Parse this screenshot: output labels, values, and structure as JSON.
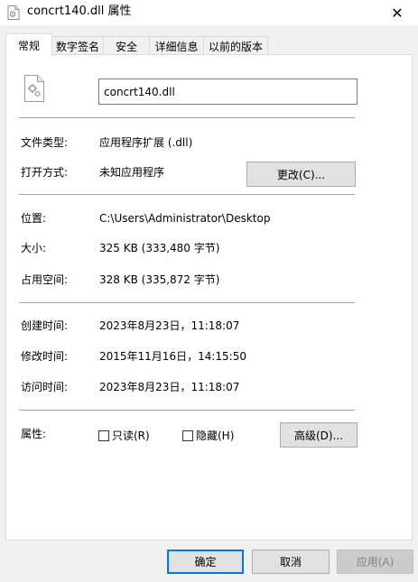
{
  "window": {
    "title": "concrt140.dll 属性",
    "close_glyph": "✕"
  },
  "tabs": [
    {
      "label": "常规",
      "active": true
    },
    {
      "label": "数字签名",
      "active": false
    },
    {
      "label": "安全",
      "active": false
    },
    {
      "label": "详细信息",
      "active": false
    },
    {
      "label": "以前的版本",
      "active": false
    }
  ],
  "general": {
    "filename": "concrt140.dll",
    "file_type_label": "文件类型:",
    "file_type_value": "应用程序扩展 (.dll)",
    "open_with_label": "打开方式:",
    "open_with_value": "未知应用程序",
    "change_button": "更改(C)...",
    "location_label": "位置:",
    "location_value": "C:\\Users\\Administrator\\Desktop",
    "size_label": "大小:",
    "size_value": "325 KB (333,480 字节)",
    "disk_size_label": "占用空间:",
    "disk_size_value": "328 KB (335,872 字节)",
    "created_label": "创建时间:",
    "created_value": "2023年8月23日，11:18:07",
    "modified_label": "修改时间:",
    "modified_value": "2015年11月16日，14:15:50",
    "accessed_label": "访问时间:",
    "accessed_value": "2023年8月23日，11:18:07",
    "attributes_label": "属性:",
    "readonly_label": "只读(R)",
    "readonly_checked": false,
    "hidden_label": "隐藏(H)",
    "hidden_checked": false,
    "advanced_button": "高级(D)..."
  },
  "footer": {
    "ok": "确定",
    "cancel": "取消",
    "apply": "应用(A)"
  },
  "icons": {
    "title": "dll-file-icon",
    "file": "dll-file-gear-icon"
  }
}
